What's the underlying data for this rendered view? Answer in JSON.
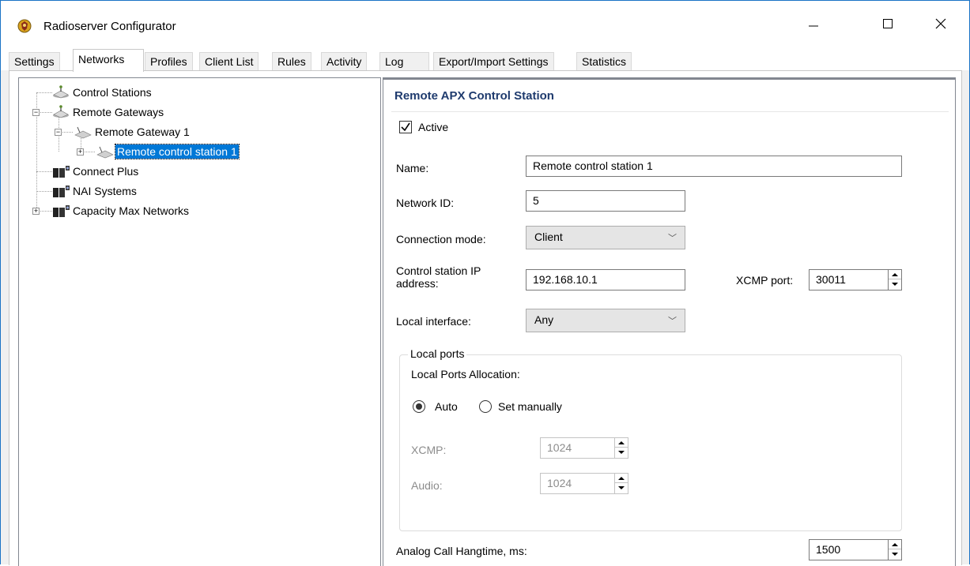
{
  "window": {
    "title": "Radioserver Configurator",
    "border_color": "#1a73c6"
  },
  "tabs": {
    "settings": "Settings",
    "networks": "Networks",
    "profiles": "Profiles",
    "client_list": "Client List",
    "rules": "Rules",
    "activity": "Activity",
    "log": "Log",
    "export_import": "Export/Import Settings",
    "statistics": "Statistics",
    "active": "Networks"
  },
  "tree": {
    "control_stations": "Control Stations",
    "remote_gateways": "Remote Gateways",
    "remote_gateway_1": "Remote Gateway 1",
    "remote_control_station_1": "Remote control station 1",
    "connect_plus": "Connect Plus",
    "nai_systems": "NAI Systems",
    "capacity_max": "Capacity Max Networks",
    "selected_color": "#0078d7"
  },
  "detail": {
    "header": "Remote APX Control Station",
    "active_label": "Active",
    "active_checked": true,
    "name_label": "Name:",
    "name_value": "Remote control station 1",
    "network_id_label": "Network ID:",
    "network_id_value": "5",
    "connection_mode_label": "Connection mode:",
    "connection_mode_value": "Client",
    "cs_ip_label_line1": "Control station IP",
    "cs_ip_label_line2": "address:",
    "cs_ip_value": "192.168.10.1",
    "xcmp_port_label": "XCMP port:",
    "xcmp_port_value": "30011",
    "local_interface_label": "Local interface:",
    "local_interface_value": "Any",
    "local_ports_group": "Local ports",
    "local_ports_allocation_label": "Local Ports Allocation:",
    "auto_label": "Auto",
    "set_manually_label": "Set manually",
    "allocation_selected": "Auto",
    "xcmp_label": "XCMP:",
    "xcmp_value": "1024",
    "audio_label": "Audio:",
    "audio_value": "1024",
    "hangtime_label": "Analog Call Hangtime, ms:",
    "hangtime_value": "1500",
    "header_color": "#1f3b6e"
  }
}
